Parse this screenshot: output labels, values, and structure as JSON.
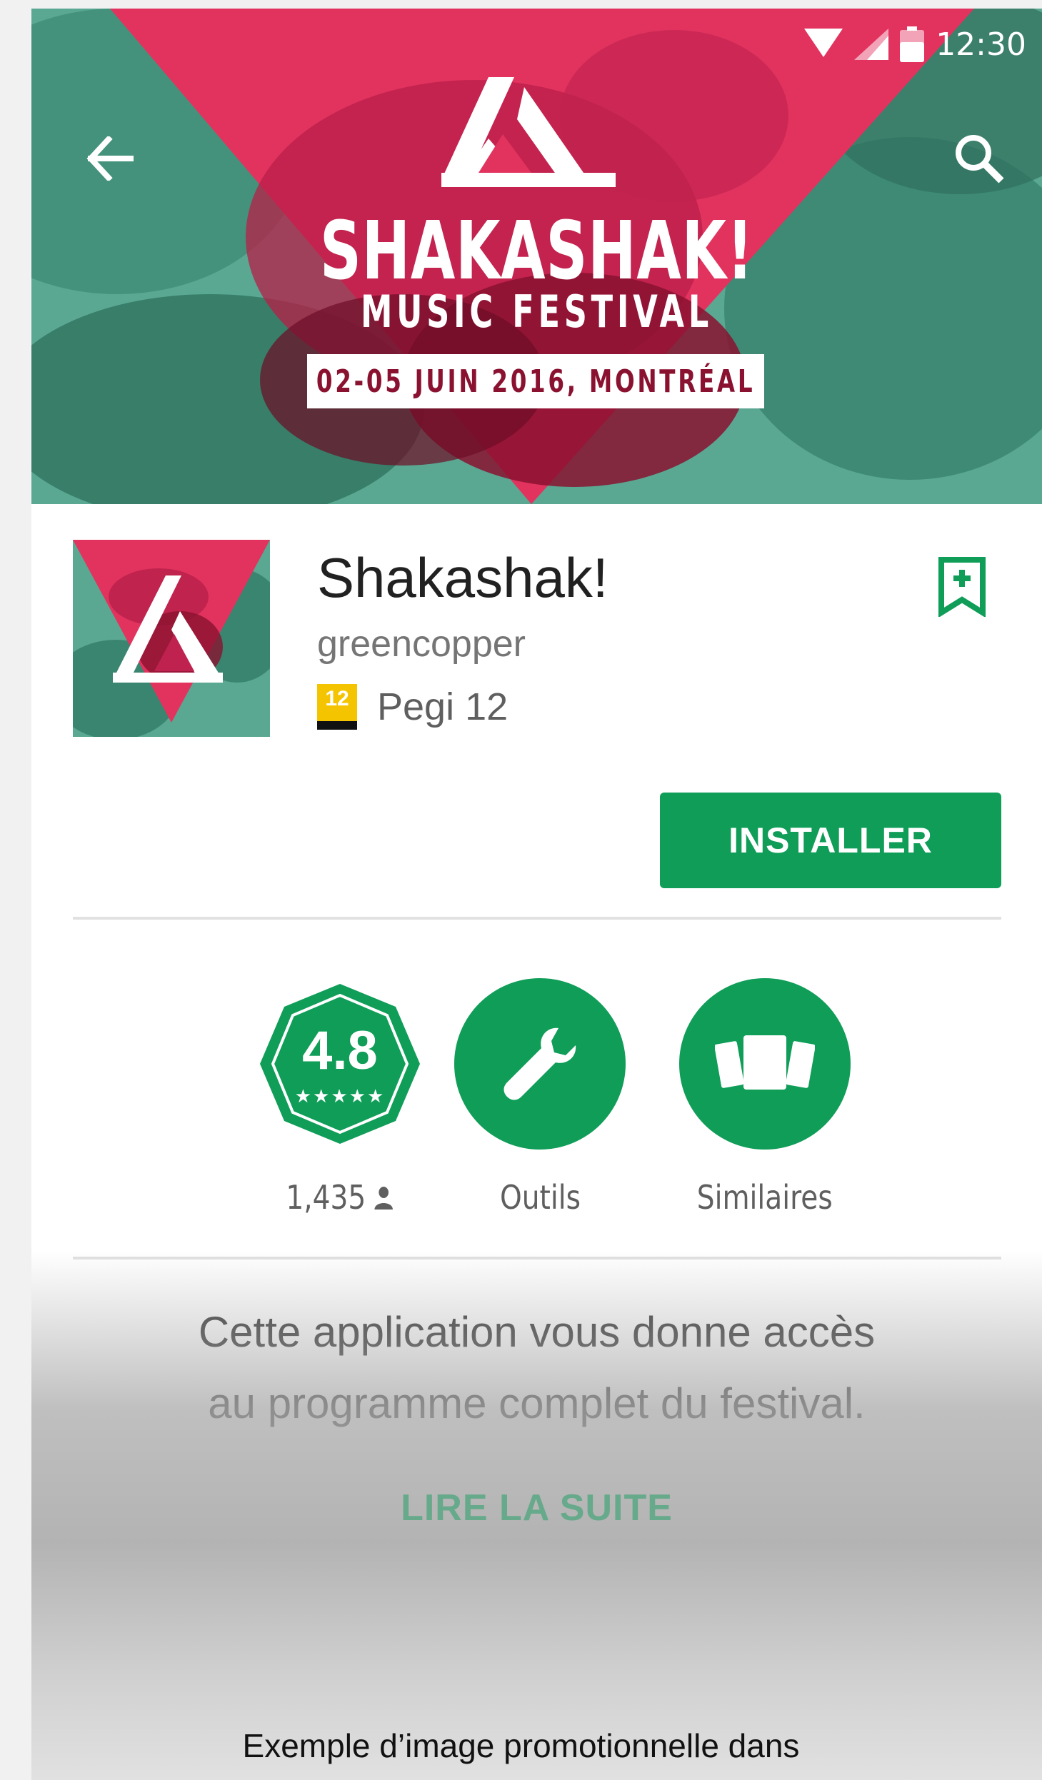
{
  "status_bar": {
    "time": "12:30",
    "icons": [
      "wifi-icon",
      "signal-icon",
      "battery-icon"
    ]
  },
  "app_bar": {
    "back_icon": "arrow-left-icon",
    "search_icon": "search-icon"
  },
  "hero": {
    "title": "SHAKASHAK!",
    "subtitle": "MUSIC FESTIVAL",
    "date_banner": "02-05 JUIN 2016, MONTRÉAL",
    "colors": {
      "pink": "#e2335f",
      "teal": "#4f9f88",
      "dark": "#7a1027"
    }
  },
  "app": {
    "name": "Shakashak!",
    "developer": "greencopper",
    "pegi_badge": "12",
    "pegi_label": "Pegi 12",
    "install_label": "INSTALLER",
    "accent": "#0f9d58"
  },
  "stats": {
    "rating_value": "4.8",
    "rating_stars": "★★★★★",
    "rating_count": "1,435",
    "tools_label": "Outils",
    "similar_label": "Similaires"
  },
  "description": {
    "line1": "Cette application vous donne accès",
    "line2": "au programme complet du festival.",
    "read_more": "LIRE LA SUITE"
  },
  "caption": "Exemple d’image promotionnelle dans"
}
